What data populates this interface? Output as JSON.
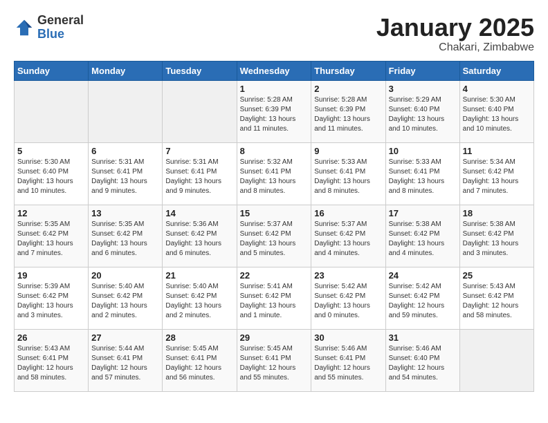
{
  "logo": {
    "general": "General",
    "blue": "Blue"
  },
  "title": "January 2025",
  "subtitle": "Chakari, Zimbabwe",
  "headers": [
    "Sunday",
    "Monday",
    "Tuesday",
    "Wednesday",
    "Thursday",
    "Friday",
    "Saturday"
  ],
  "weeks": [
    [
      {
        "day": "",
        "info": ""
      },
      {
        "day": "",
        "info": ""
      },
      {
        "day": "",
        "info": ""
      },
      {
        "day": "1",
        "info": "Sunrise: 5:28 AM\nSunset: 6:39 PM\nDaylight: 13 hours\nand 11 minutes."
      },
      {
        "day": "2",
        "info": "Sunrise: 5:28 AM\nSunset: 6:39 PM\nDaylight: 13 hours\nand 11 minutes."
      },
      {
        "day": "3",
        "info": "Sunrise: 5:29 AM\nSunset: 6:40 PM\nDaylight: 13 hours\nand 10 minutes."
      },
      {
        "day": "4",
        "info": "Sunrise: 5:30 AM\nSunset: 6:40 PM\nDaylight: 13 hours\nand 10 minutes."
      }
    ],
    [
      {
        "day": "5",
        "info": "Sunrise: 5:30 AM\nSunset: 6:40 PM\nDaylight: 13 hours\nand 10 minutes."
      },
      {
        "day": "6",
        "info": "Sunrise: 5:31 AM\nSunset: 6:41 PM\nDaylight: 13 hours\nand 9 minutes."
      },
      {
        "day": "7",
        "info": "Sunrise: 5:31 AM\nSunset: 6:41 PM\nDaylight: 13 hours\nand 9 minutes."
      },
      {
        "day": "8",
        "info": "Sunrise: 5:32 AM\nSunset: 6:41 PM\nDaylight: 13 hours\nand 8 minutes."
      },
      {
        "day": "9",
        "info": "Sunrise: 5:33 AM\nSunset: 6:41 PM\nDaylight: 13 hours\nand 8 minutes."
      },
      {
        "day": "10",
        "info": "Sunrise: 5:33 AM\nSunset: 6:41 PM\nDaylight: 13 hours\nand 8 minutes."
      },
      {
        "day": "11",
        "info": "Sunrise: 5:34 AM\nSunset: 6:42 PM\nDaylight: 13 hours\nand 7 minutes."
      }
    ],
    [
      {
        "day": "12",
        "info": "Sunrise: 5:35 AM\nSunset: 6:42 PM\nDaylight: 13 hours\nand 7 minutes."
      },
      {
        "day": "13",
        "info": "Sunrise: 5:35 AM\nSunset: 6:42 PM\nDaylight: 13 hours\nand 6 minutes."
      },
      {
        "day": "14",
        "info": "Sunrise: 5:36 AM\nSunset: 6:42 PM\nDaylight: 13 hours\nand 6 minutes."
      },
      {
        "day": "15",
        "info": "Sunrise: 5:37 AM\nSunset: 6:42 PM\nDaylight: 13 hours\nand 5 minutes."
      },
      {
        "day": "16",
        "info": "Sunrise: 5:37 AM\nSunset: 6:42 PM\nDaylight: 13 hours\nand 4 minutes."
      },
      {
        "day": "17",
        "info": "Sunrise: 5:38 AM\nSunset: 6:42 PM\nDaylight: 13 hours\nand 4 minutes."
      },
      {
        "day": "18",
        "info": "Sunrise: 5:38 AM\nSunset: 6:42 PM\nDaylight: 13 hours\nand 3 minutes."
      }
    ],
    [
      {
        "day": "19",
        "info": "Sunrise: 5:39 AM\nSunset: 6:42 PM\nDaylight: 13 hours\nand 3 minutes."
      },
      {
        "day": "20",
        "info": "Sunrise: 5:40 AM\nSunset: 6:42 PM\nDaylight: 13 hours\nand 2 minutes."
      },
      {
        "day": "21",
        "info": "Sunrise: 5:40 AM\nSunset: 6:42 PM\nDaylight: 13 hours\nand 2 minutes."
      },
      {
        "day": "22",
        "info": "Sunrise: 5:41 AM\nSunset: 6:42 PM\nDaylight: 13 hours\nand 1 minute."
      },
      {
        "day": "23",
        "info": "Sunrise: 5:42 AM\nSunset: 6:42 PM\nDaylight: 13 hours\nand 0 minutes."
      },
      {
        "day": "24",
        "info": "Sunrise: 5:42 AM\nSunset: 6:42 PM\nDaylight: 12 hours\nand 59 minutes."
      },
      {
        "day": "25",
        "info": "Sunrise: 5:43 AM\nSunset: 6:42 PM\nDaylight: 12 hours\nand 58 minutes."
      }
    ],
    [
      {
        "day": "26",
        "info": "Sunrise: 5:43 AM\nSunset: 6:41 PM\nDaylight: 12 hours\nand 58 minutes."
      },
      {
        "day": "27",
        "info": "Sunrise: 5:44 AM\nSunset: 6:41 PM\nDaylight: 12 hours\nand 57 minutes."
      },
      {
        "day": "28",
        "info": "Sunrise: 5:45 AM\nSunset: 6:41 PM\nDaylight: 12 hours\nand 56 minutes."
      },
      {
        "day": "29",
        "info": "Sunrise: 5:45 AM\nSunset: 6:41 PM\nDaylight: 12 hours\nand 55 minutes."
      },
      {
        "day": "30",
        "info": "Sunrise: 5:46 AM\nSunset: 6:41 PM\nDaylight: 12 hours\nand 55 minutes."
      },
      {
        "day": "31",
        "info": "Sunrise: 5:46 AM\nSunset: 6:40 PM\nDaylight: 12 hours\nand 54 minutes."
      },
      {
        "day": "",
        "info": ""
      }
    ]
  ]
}
